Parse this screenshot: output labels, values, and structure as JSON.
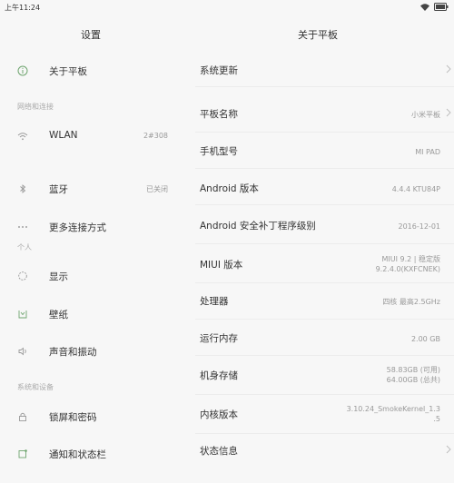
{
  "status_bar": {
    "time": "上午11:24"
  },
  "left_pane": {
    "title": "设置",
    "about": "关于平板",
    "section_network": "网络和连接",
    "wlan": {
      "label": "WLAN",
      "value": "2#308"
    },
    "bluetooth": {
      "label": "蓝牙",
      "value": "已关闭"
    },
    "more_connections": "更多连接方式",
    "section_personal": "个人",
    "display": "显示",
    "wallpaper": "壁纸",
    "sound": "声音和振动",
    "section_system": "系统和设备",
    "lockscreen": "锁屏和密码",
    "notifications": "通知和状态栏"
  },
  "right_pane": {
    "title": "关于平板",
    "items": [
      {
        "label": "系统更新",
        "value": ""
      },
      {
        "label": "平板名称",
        "value": "小米平板"
      },
      {
        "label": "手机型号",
        "value": "MI PAD"
      },
      {
        "label": "Android 版本",
        "value": "4.4.4 KTU84P"
      },
      {
        "label": "Android 安全补丁程序级别",
        "value": "2016-12-01"
      },
      {
        "label": "MIUI 版本",
        "value": "MIUI 9.2 | 稳定版",
        "value2": "9.2.4.0(KXFCNEK)"
      },
      {
        "label": "处理器",
        "value": "四核 最高2.5GHz"
      },
      {
        "label": "运行内存",
        "value": "2.00 GB"
      },
      {
        "label": "机身存储",
        "value": "58.83GB (可用)",
        "value2": "64.00GB (总共)"
      },
      {
        "label": "内核版本",
        "value": "3.10.24_SmokeKernel_1.3",
        "value2": ".5"
      },
      {
        "label": "状态信息",
        "value": ""
      }
    ]
  }
}
